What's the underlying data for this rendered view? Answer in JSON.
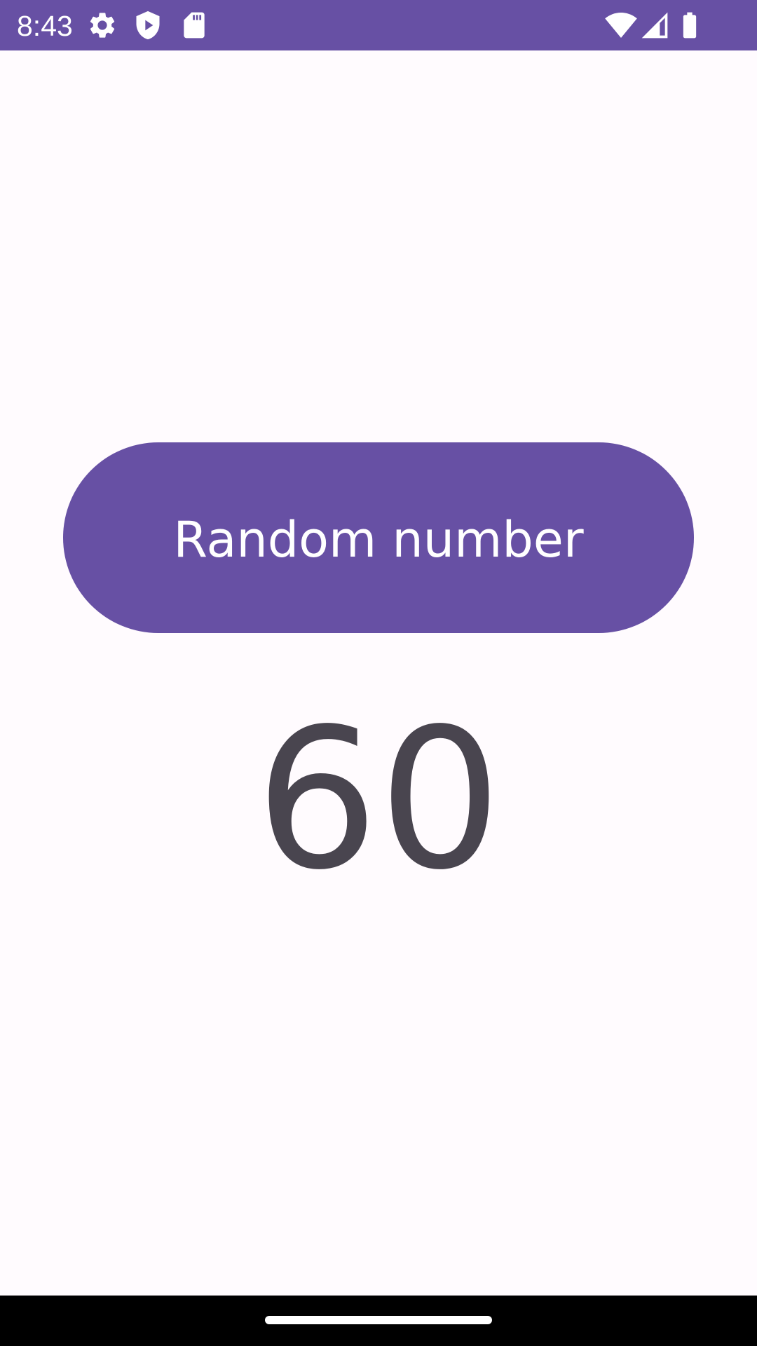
{
  "status_bar": {
    "time": "8:43",
    "background_color": "#6750A4",
    "left_icons": [
      "gear-icon",
      "shield-play-icon",
      "sd-card-icon"
    ],
    "right_icons": [
      "wifi-icon",
      "cell-signal-icon",
      "battery-icon"
    ]
  },
  "main": {
    "button_label": "Random number",
    "random_value": "60",
    "accent_color": "#6750A4",
    "value_color": "#49454F",
    "background_color": "#FFFBFE"
  },
  "nav_bar": {
    "background_color": "#000000",
    "handle_icon": "home-gesture-handle"
  }
}
